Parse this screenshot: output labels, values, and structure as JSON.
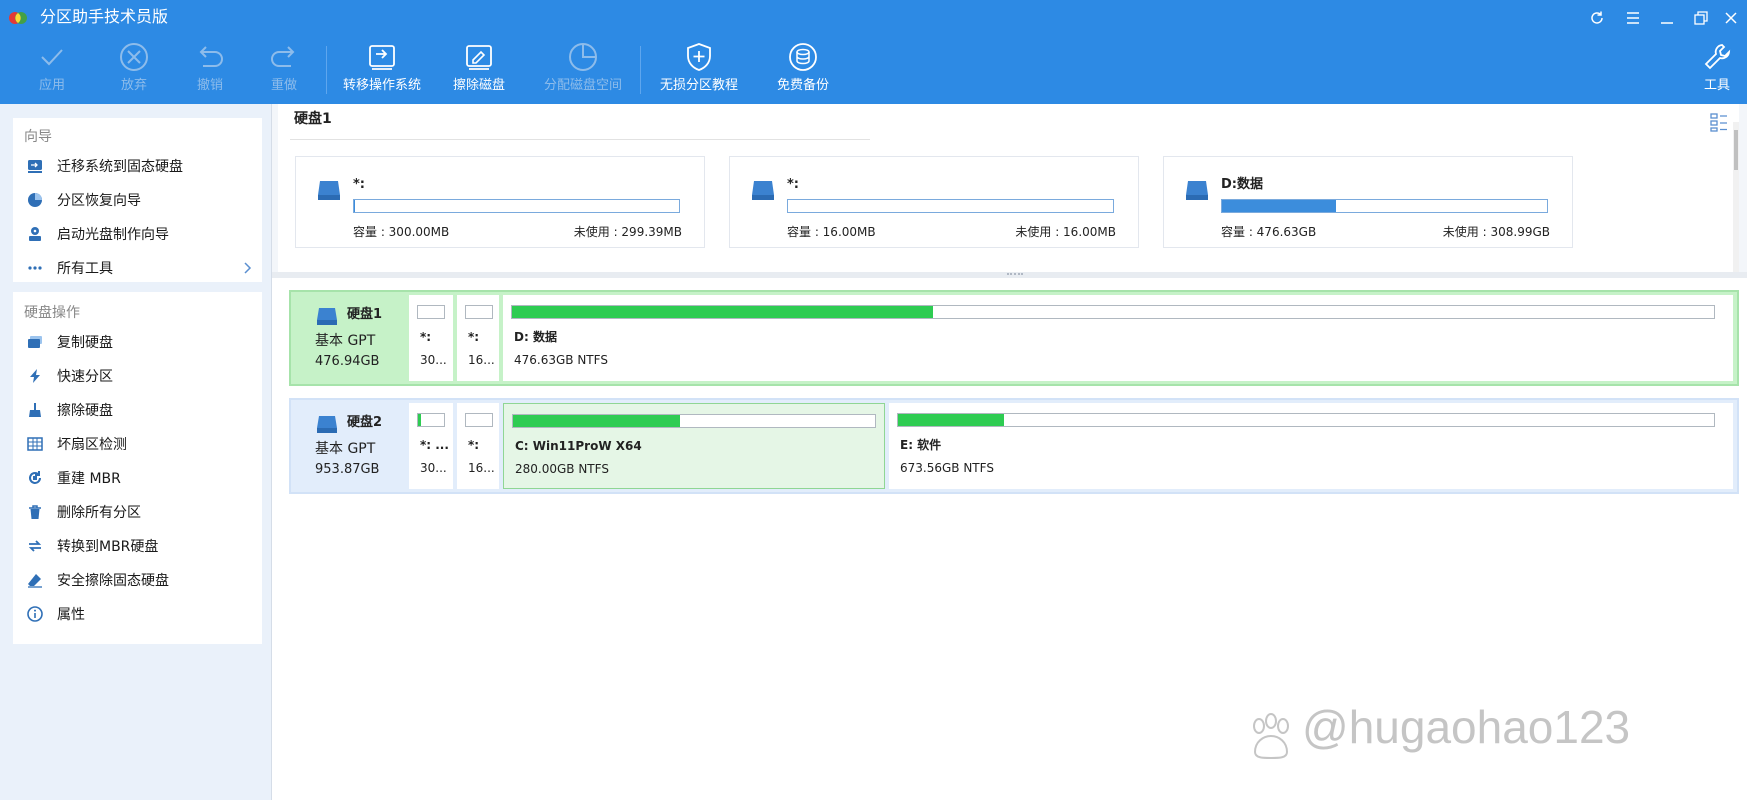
{
  "app": {
    "title": "分区助手技术员版"
  },
  "toolbar": {
    "apply": "应用",
    "discard": "放弃",
    "undo": "撤销",
    "redo": "重做",
    "migrate_os": "转移操作系统",
    "wipe_disk": "擦除磁盘",
    "allocate_space": "分配磁盘空间",
    "lossless_tutorial": "无损分区教程",
    "free_backup": "免费备份",
    "tools": "工具"
  },
  "sidebar": {
    "wizard_heading": "向导",
    "wizard_items": [
      {
        "label": "迁移系统到固态硬盘",
        "icon": "migrate-disk-icon"
      },
      {
        "label": "分区恢复向导",
        "icon": "pie-recovery-icon"
      },
      {
        "label": "启动光盘制作向导",
        "icon": "boot-disc-icon"
      },
      {
        "label": "所有工具",
        "icon": "more-dots-icon"
      }
    ],
    "disk_ops_heading": "硬盘操作",
    "disk_ops_items": [
      {
        "label": "复制硬盘",
        "icon": "copy-disk-icon"
      },
      {
        "label": "快速分区",
        "icon": "lightning-icon"
      },
      {
        "label": "擦除硬盘",
        "icon": "broom-icon"
      },
      {
        "label": "坏扇区检测",
        "icon": "bad-sector-icon"
      },
      {
        "label": "重建 MBR",
        "icon": "rebuild-mbr-icon"
      },
      {
        "label": "删除所有分区",
        "icon": "trash-icon"
      },
      {
        "label": "转换到MBR硬盘",
        "icon": "convert-icon"
      },
      {
        "label": "安全擦除固态硬盘",
        "icon": "eraser-icon"
      },
      {
        "label": "属性",
        "icon": "info-icon"
      }
    ]
  },
  "disk_info": {
    "title": "硬盘1",
    "cards": [
      {
        "name": "*:",
        "capacity": "容量 : 300.00MB",
        "unused": "未使用 : 299.39MB",
        "used_fraction": 0.002
      },
      {
        "name": "*:",
        "capacity": "容量 : 16.00MB",
        "unused": "未使用 : 16.00MB",
        "used_fraction": 0
      },
      {
        "name": "D:数据",
        "capacity": "容量 : 476.63GB",
        "unused": "未使用 : 308.99GB",
        "used_fraction": 0.35
      }
    ]
  },
  "disks": [
    {
      "name": "硬盘1",
      "type": "基本 GPT",
      "size": "476.94GB",
      "partitions": [
        {
          "name": "*:",
          "info": "30...",
          "used_fraction": 0.002
        },
        {
          "name": "*:",
          "info": "16...",
          "used_fraction": 0
        },
        {
          "name": "D: 数据",
          "info": "476.63GB NTFS",
          "used_fraction": 0.35
        }
      ]
    },
    {
      "name": "硬盘2",
      "type": "基本 GPT",
      "size": "953.87GB",
      "partitions": [
        {
          "name": "*: ...",
          "info": "30...",
          "used_fraction": 0.12
        },
        {
          "name": "*:",
          "info": "16...",
          "used_fraction": 0
        },
        {
          "name": "C: Win11ProW X64",
          "info": "280.00GB NTFS",
          "used_fraction": 0.46
        },
        {
          "name": "E: 软件",
          "info": "673.56GB NTFS",
          "used_fraction": 0.13
        }
      ]
    }
  ],
  "watermark": {
    "text": "@hugaohao123"
  }
}
